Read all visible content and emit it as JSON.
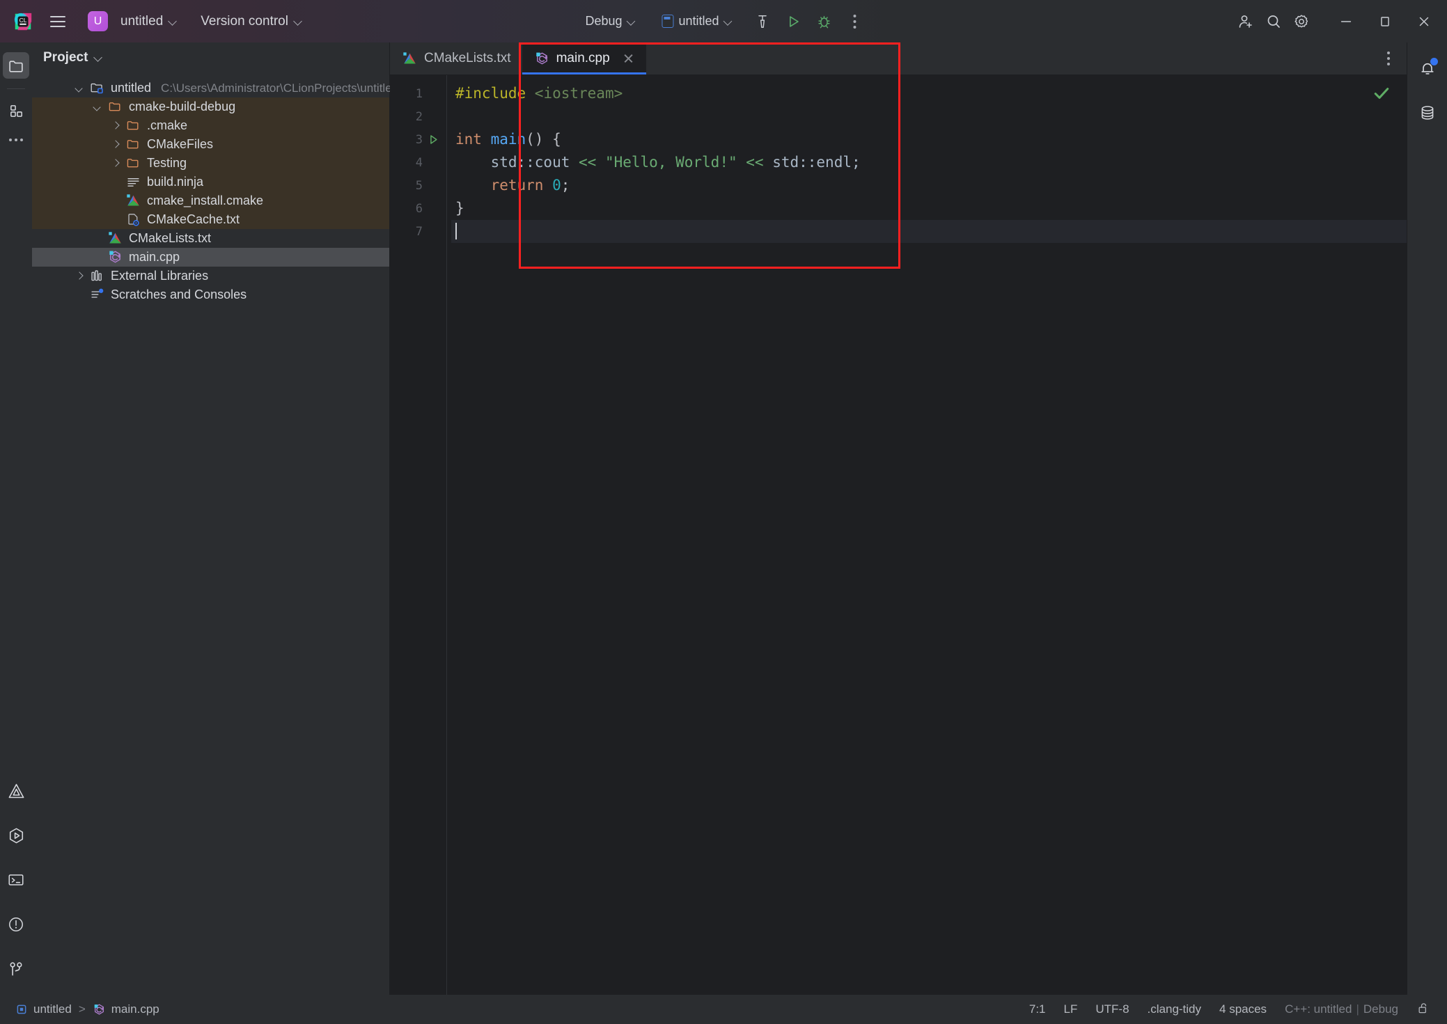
{
  "titlebar": {
    "menu_icon": "hamburger-menu-icon",
    "logo_icon": "clion-logo-icon",
    "project_badge": "U",
    "project_name": "untitled",
    "vcs_label": "Version control",
    "run_config_label": "Debug",
    "run_target_label": "untitled",
    "build_icon": "hammer-icon",
    "run_icon": "run-triangle-icon",
    "debug_icon": "debug-bug-icon",
    "more_icon": "more-vertical-icon",
    "account_icon": "add-user-icon",
    "search_icon": "search-icon",
    "settings_icon": "gear-icon",
    "minimize_icon": "minimize-icon",
    "maximize_icon": "maximize-icon",
    "close_icon": "close-icon"
  },
  "left_stripe": {
    "top": [
      {
        "name": "project-tool-window",
        "icon": "folder-icon",
        "active": true
      },
      {
        "name": "structure-tool-window",
        "icon": "squares-icon",
        "active": false
      },
      {
        "name": "more-tool-windows",
        "icon": "more-horizontal-icon",
        "active": false
      }
    ],
    "bottom": [
      {
        "name": "cmake-tool-window",
        "icon": "cmake-triangle-icon"
      },
      {
        "name": "run-tool-window",
        "icon": "run-hexagon-icon"
      },
      {
        "name": "terminal-tool-window",
        "icon": "terminal-icon"
      },
      {
        "name": "problems-tool-window",
        "icon": "warning-circle-icon"
      },
      {
        "name": "version-control-tool-window",
        "icon": "branch-icon"
      }
    ]
  },
  "project_panel": {
    "title": "Project",
    "title_chevron": "chevron-down-icon",
    "tree": [
      {
        "label": "untitled",
        "path": "C:\\Users\\Administrator\\CLionProjects\\untitled",
        "indent": 0,
        "arrow": "down",
        "icon": "module-folder-icon",
        "state": "normal"
      },
      {
        "label": "cmake-build-debug",
        "path": "",
        "indent": 1,
        "arrow": "down",
        "icon": "folder-orange-icon",
        "state": "build"
      },
      {
        "label": ".cmake",
        "path": "",
        "indent": 2,
        "arrow": "right",
        "icon": "folder-orange-icon",
        "state": "build"
      },
      {
        "label": "CMakeFiles",
        "path": "",
        "indent": 2,
        "arrow": "right",
        "icon": "folder-orange-icon",
        "state": "build"
      },
      {
        "label": "Testing",
        "path": "",
        "indent": 2,
        "arrow": "right",
        "icon": "folder-orange-icon",
        "state": "build"
      },
      {
        "label": "build.ninja",
        "path": "",
        "indent": 2,
        "arrow": "none",
        "icon": "text-lines-icon",
        "state": "build"
      },
      {
        "label": "cmake_install.cmake",
        "path": "",
        "indent": 2,
        "arrow": "none",
        "icon": "cmake-triangle-icon",
        "state": "build"
      },
      {
        "label": "CMakeCache.txt",
        "path": "",
        "indent": 2,
        "arrow": "none",
        "icon": "file-gear-icon",
        "state": "build"
      },
      {
        "label": "CMakeLists.txt",
        "path": "",
        "indent": 1,
        "arrow": "none",
        "icon": "cmake-triangle-icon",
        "state": "normal"
      },
      {
        "label": "main.cpp",
        "path": "",
        "indent": 1,
        "arrow": "none",
        "icon": "cpp-file-icon",
        "state": "selected"
      },
      {
        "label": "External Libraries",
        "path": "",
        "indent": 0,
        "arrow": "right",
        "icon": "libraries-icon",
        "state": "normal"
      },
      {
        "label": "Scratches and Consoles",
        "path": "",
        "indent": 0,
        "arrow": "none",
        "icon": "scratches-icon",
        "state": "normal"
      }
    ]
  },
  "editor": {
    "tabs": [
      {
        "label": "CMakeLists.txt",
        "icon": "cmake-triangle-icon",
        "active": false,
        "closable": false
      },
      {
        "label": "main.cpp",
        "icon": "cpp-file-icon",
        "active": true,
        "closable": true,
        "close_icon": "close-icon"
      }
    ],
    "tabs_more_icon": "more-vertical-icon",
    "inspection_status_icon": "checkmark-icon",
    "line_numbers": [
      "1",
      "2",
      "3",
      "4",
      "5",
      "6",
      "7"
    ],
    "run_gutter_line": 3,
    "run_gutter_icon": "run-triangle-icon",
    "caret_line": 7,
    "lines": [
      {
        "n": 1,
        "tokens": [
          {
            "t": "#include ",
            "c": "k-pre"
          },
          {
            "t": "<iostream>",
            "c": "k-inc"
          }
        ]
      },
      {
        "n": 2,
        "tokens": []
      },
      {
        "n": 3,
        "tokens": [
          {
            "t": "int ",
            "c": "k-kw"
          },
          {
            "t": "main",
            "c": "k-fn"
          },
          {
            "t": "() {",
            "c": "k-punct"
          }
        ]
      },
      {
        "n": 4,
        "tokens": [
          {
            "t": "    std::cout ",
            "c": "k-id"
          },
          {
            "t": "<< ",
            "c": "k-op"
          },
          {
            "t": "\"Hello, World!\"",
            "c": "k-str"
          },
          {
            "t": " << ",
            "c": "k-op"
          },
          {
            "t": "std::endl;",
            "c": "k-id"
          }
        ]
      },
      {
        "n": 5,
        "tokens": [
          {
            "t": "    return ",
            "c": "k-kw"
          },
          {
            "t": "0",
            "c": "k-num"
          },
          {
            "t": ";",
            "c": "k-punct"
          }
        ]
      },
      {
        "n": 6,
        "tokens": [
          {
            "t": "}",
            "c": "k-punct"
          }
        ]
      },
      {
        "n": 7,
        "tokens": []
      }
    ]
  },
  "right_stripe": [
    {
      "name": "notifications-tool-window",
      "icon": "bell-icon",
      "badge": true
    },
    {
      "name": "database-tool-window",
      "icon": "database-icon",
      "badge": false
    }
  ],
  "statusbar": {
    "breadcrumb_project": "untitled",
    "breadcrumb_separator": ">",
    "breadcrumb_file": "main.cpp",
    "breadcrumb_project_icon": "module-icon",
    "breadcrumb_file_icon": "cpp-file-icon",
    "caret_position": "7:1",
    "line_separator": "LF",
    "encoding": "UTF-8",
    "inspection_profile": ".clang-tidy",
    "indent": "4 spaces",
    "toolchain": "C++: untitled",
    "toolchain_sep": "|",
    "build_type": "Debug",
    "lock_icon": "unlocked-icon"
  },
  "annotation": {
    "redbox_label": "editor-highlight-box",
    "color": "#ff2020"
  }
}
